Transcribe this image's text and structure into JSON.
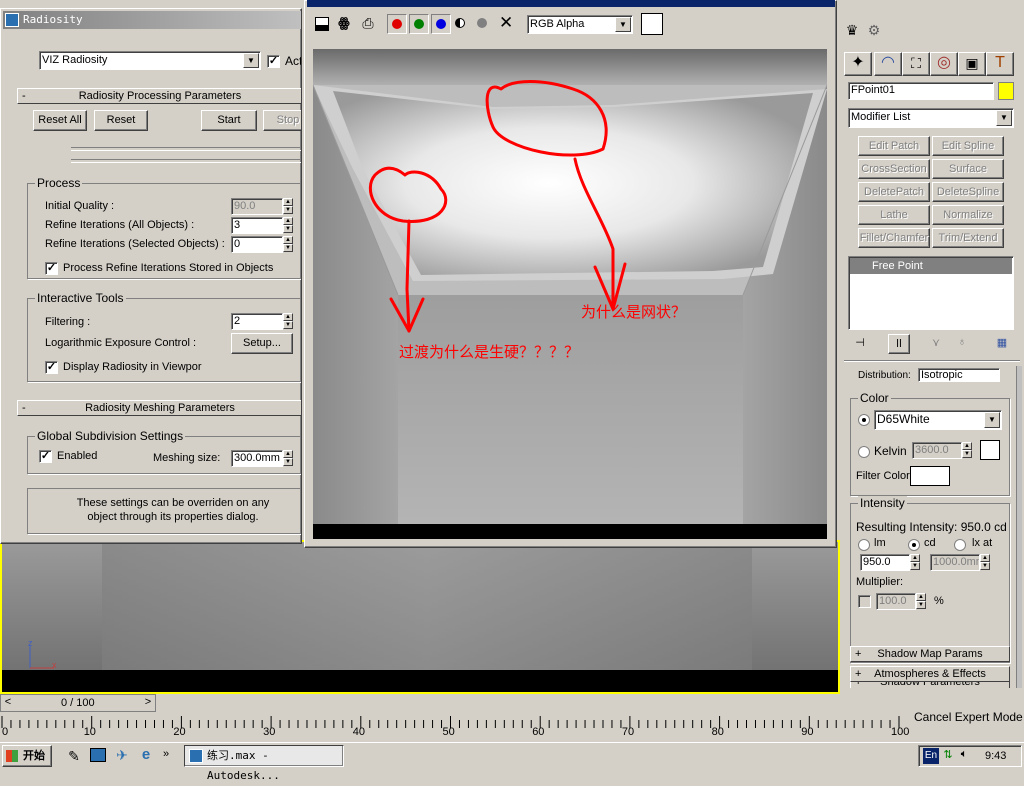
{
  "radiosity": {
    "title": "Radiosity",
    "engine": "VIZ Radiosity",
    "active_label": "Act",
    "processing": {
      "header": "Radiosity Processing Parameters",
      "reset_all": "Reset All",
      "reset": "Reset",
      "start": "Start",
      "stop": "Stop",
      "process_group": "Process",
      "initial_quality_label": "Initial Quality :",
      "initial_quality_value": "90.0",
      "refine_all_label": "Refine Iterations (All Objects) :",
      "refine_all_value": "3",
      "refine_sel_label": "Refine Iterations (Selected Objects) :",
      "refine_sel_value": "0",
      "process_stored_label": "Process Refine Iterations Stored in Objects",
      "interactive_group": "Interactive Tools",
      "filtering_label": "Filtering :",
      "filtering_value": "2",
      "log_exposure_label": "Logarithmic Exposure Control :",
      "setup_button": "Setup...",
      "display_radiosity_label": "Display Radiosity in Viewpor"
    },
    "meshing": {
      "header": "Radiosity Meshing Parameters",
      "group": "Global Subdivision Settings",
      "enabled_label": "Enabled",
      "meshing_size_label": "Meshing size:",
      "meshing_size_value": "300.0mm",
      "info_text": "These settings can be overriden on any object through its properties dialog."
    }
  },
  "render_window": {
    "channel": "RGB Alpha",
    "annotations": [
      {
        "text": "为什么是网状？"
      },
      {
        "text": "过渡为什么是生硬？？？？"
      }
    ]
  },
  "command_panel": {
    "object_name": "FPoint01",
    "object_color": "#ffff00",
    "modifier_list": "Modifier List",
    "modifier_buttons": [
      "Edit Patch",
      "Edit Spline",
      "CrossSection",
      "Surface",
      "DeletePatch",
      "DeleteSpline",
      "Lathe",
      "Normalize Spl.",
      "Fillet/Chamfer",
      "Trim/Extend"
    ],
    "stack_item": "Free Point",
    "distribution_cut": "Distribution:",
    "distribution_value": "Isotropic",
    "color_group": "Color",
    "color_preset": "D65White",
    "kelvin_label": "Kelvin",
    "kelvin_value": "3600.0",
    "filter_color_label": "Filter Color:",
    "intensity_group": "Intensity",
    "resulting_intensity": "Resulting Intensity:  950.0 cd",
    "unit_lm": "lm",
    "unit_cd": "cd",
    "unit_lx": "lx at",
    "intensity_value": "950.0",
    "distance_value": "1000.0mm",
    "multiplier_label": "Multiplier:",
    "multiplier_value": "100.0",
    "percent": "%",
    "rollouts": [
      "Shadow Parameters",
      "Shadow Map Params",
      "Atmospheres & Effects"
    ]
  },
  "timeline": {
    "frame_counter": "0 / 100",
    "ticks": [
      "0",
      "10",
      "20",
      "30",
      "40",
      "50",
      "60",
      "70",
      "80",
      "90",
      "100"
    ],
    "cancel_expert": "Cancel Expert Mode"
  },
  "taskbar": {
    "start": "开始",
    "task": "练习.max - Autodesk...",
    "clock": "9:43",
    "lang": "En"
  },
  "viewport": {
    "axis_z": "z",
    "axis_x": "x"
  },
  "colors": {
    "annotation_red": "#ff0000",
    "title_blue": "#0a246a",
    "viewport_border": "#ffff00"
  }
}
